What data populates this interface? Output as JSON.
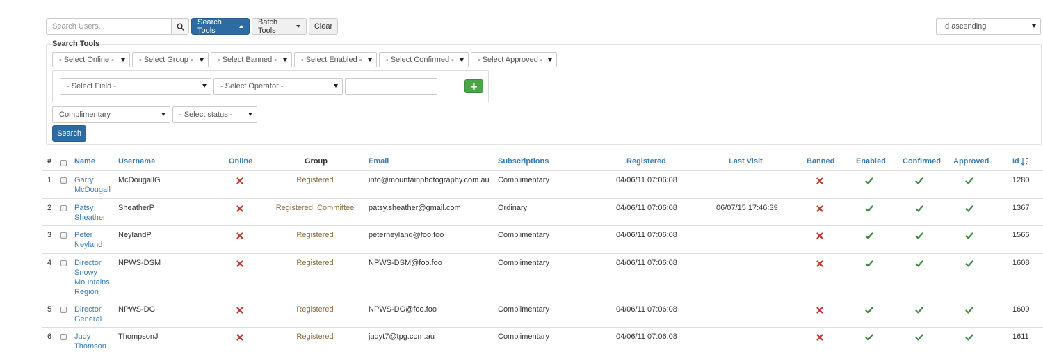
{
  "toolbar": {
    "search_placeholder": "Search Users...",
    "search_tools_label": "Search Tools",
    "batch_tools_label": "Batch Tools",
    "clear_label": "Clear",
    "sort_select": "Id ascending"
  },
  "search_tools": {
    "title": "Search Tools",
    "filters": [
      "- Select Online -",
      "- Select Group -",
      "- Select Banned -",
      "- Select Enabled -",
      "- Select Confirmed -",
      "- Select Approved -"
    ],
    "field_select": "- Select Field -",
    "operator_select": "- Select Operator -",
    "subscription_select": "Complimentary",
    "status_select": "- Select status -",
    "search_button": "Search"
  },
  "table": {
    "headers": {
      "num": "#",
      "name": "Name",
      "username": "Username",
      "online": "Online",
      "group": "Group",
      "email": "Email",
      "subscriptions": "Subscriptions",
      "registered": "Registered",
      "last_visit": "Last Visit",
      "banned": "Banned",
      "enabled": "Enabled",
      "confirmed": "Confirmed",
      "approved": "Approved",
      "id": "Id"
    },
    "rows": [
      {
        "num": "1",
        "name_lines": [
          "Garry",
          "McDougall"
        ],
        "username": "McDougallG",
        "group": "Registered",
        "email": "info@mountainphotography.com.au",
        "subscription": "Complimentary",
        "registered": "04/06/11 07:06:08",
        "last_visit": "",
        "id": "1280"
      },
      {
        "num": "2",
        "name_lines": [
          "Patsy",
          "Sheather"
        ],
        "username": "SheatherP",
        "group": "Registered, Committee",
        "email": "patsy.sheather@gmail.com",
        "subscription": "Ordinary",
        "registered": "04/06/11 07:06:08",
        "last_visit": "06/07/15 17:46:39",
        "id": "1367"
      },
      {
        "num": "3",
        "name_lines": [
          "Peter",
          "Neyland"
        ],
        "username": "NeylandP",
        "group": "Registered",
        "email": "peterneyland@foo.foo",
        "subscription": "Complimentary",
        "registered": "04/06/11 07:06:08",
        "last_visit": "",
        "id": "1566"
      },
      {
        "num": "4",
        "name_lines": [
          "Director",
          "Snowy",
          "Mountains",
          "Region"
        ],
        "username": "NPWS-DSM",
        "group": "Registered",
        "email": "NPWS-DSM@foo.foo",
        "subscription": "Complimentary",
        "registered": "04/06/11 07:06:08",
        "last_visit": "",
        "id": "1608"
      },
      {
        "num": "5",
        "name_lines": [
          "Director",
          "General"
        ],
        "username": "NPWS-DG",
        "group": "Registered",
        "email": "NPWS-DG@foo.foo",
        "subscription": "Complimentary",
        "registered": "04/06/11 07:06:08",
        "last_visit": "",
        "id": "1609"
      },
      {
        "num": "6",
        "name_lines": [
          "Judy",
          "Thomson"
        ],
        "username": "ThompsonJ",
        "group": "Registered",
        "email": "judyt7@tpg.com.au",
        "subscription": "Complimentary",
        "registered": "04/06/11 07:06:08",
        "last_visit": "",
        "id": "1611"
      }
    ]
  },
  "icons": {
    "cross": "remove-icon",
    "tick": "ok-icon"
  },
  "colors": {
    "primary": "#2d6ca2",
    "link": "#3b7cb3",
    "cross": "#c0392b",
    "tick": "#3c8b3c",
    "group": "#8a6d3b"
  }
}
